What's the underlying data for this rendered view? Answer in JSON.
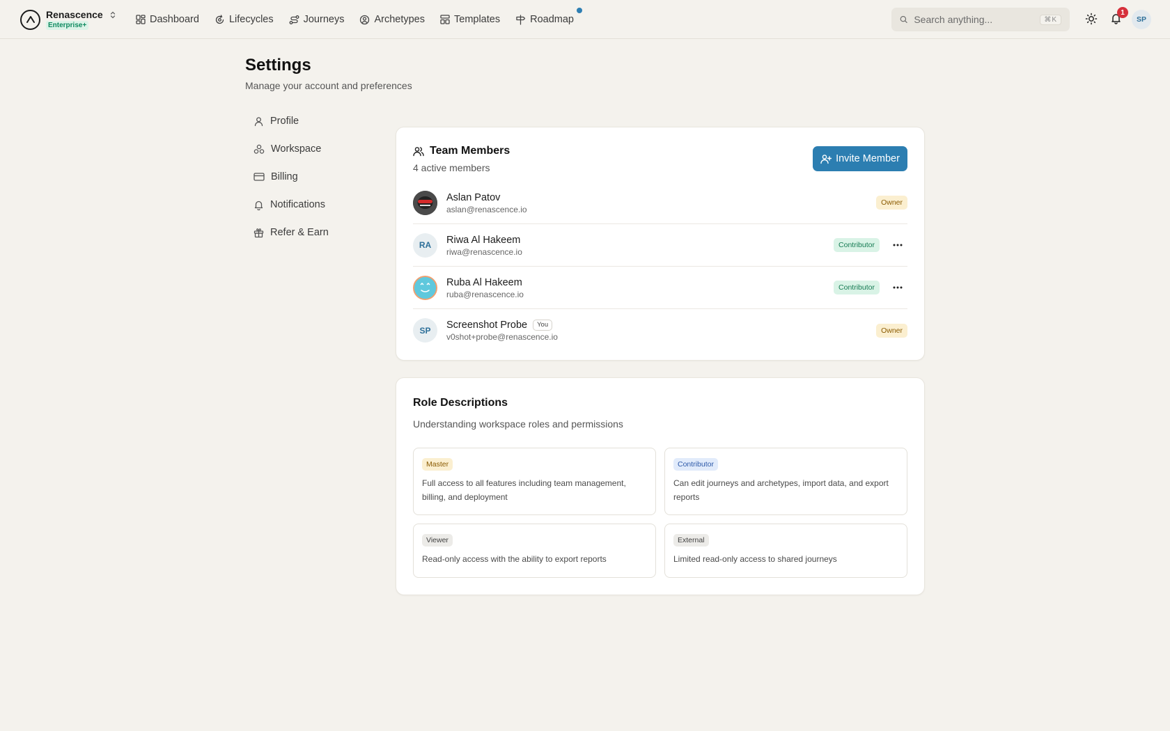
{
  "brand": {
    "name": "Renascence",
    "plan": "Enterprise+"
  },
  "nav": {
    "items": [
      {
        "label": "Dashboard",
        "icon": "grid-icon"
      },
      {
        "label": "Lifecycles",
        "icon": "cycle-icon"
      },
      {
        "label": "Journeys",
        "icon": "route-icon"
      },
      {
        "label": "Archetypes",
        "icon": "user-circle-icon"
      },
      {
        "label": "Templates",
        "icon": "template-icon"
      },
      {
        "label": "Roadmap",
        "icon": "signpost-icon"
      }
    ]
  },
  "search": {
    "placeholder": "Search anything...",
    "shortcut": "⌘K"
  },
  "notifications": {
    "count": "1"
  },
  "user": {
    "initials": "SP"
  },
  "page": {
    "title": "Settings",
    "subtitle": "Manage your account and preferences"
  },
  "side_nav": {
    "items": [
      {
        "label": "Profile",
        "icon": "user-icon"
      },
      {
        "label": "Workspace",
        "icon": "workspace-icon"
      },
      {
        "label": "Billing",
        "icon": "credit-card-icon"
      },
      {
        "label": "Notifications",
        "icon": "bell-icon"
      },
      {
        "label": "Refer & Earn",
        "icon": "gift-icon"
      }
    ]
  },
  "team": {
    "title": "Team Members",
    "subtitle": "4 active members",
    "invite_label": "Invite Member",
    "members": [
      {
        "name": "Aslan Patov",
        "email": "aslan@renascence.io",
        "role": "Owner",
        "initials": ""
      },
      {
        "name": "Riwa Al Hakeem",
        "email": "riwa@renascence.io",
        "role": "Contributor",
        "initials": "RA"
      },
      {
        "name": "Ruba Al Hakeem",
        "email": "ruba@renascence.io",
        "role": "Contributor",
        "initials": ""
      },
      {
        "name": "Screenshot Probe",
        "email": "v0shot+probe@renascence.io",
        "role": "Owner",
        "initials": "SP",
        "you_label": "You"
      }
    ]
  },
  "roles": {
    "title": "Role Descriptions",
    "subtitle": "Understanding workspace roles and permissions",
    "items": [
      {
        "name": "Master",
        "description": "Full access to all features including team management, billing, and deployment"
      },
      {
        "name": "Contributor",
        "description": "Can edit journeys and archetypes, import data, and export reports"
      },
      {
        "name": "Viewer",
        "description": "Read-only access with the ability to export reports"
      },
      {
        "name": "External",
        "description": "Limited read-only access to shared journeys"
      }
    ]
  },
  "colors": {
    "accent": "#2c7eb1",
    "background": "#f4f2ed",
    "owner_badge": "#fbefd0",
    "contributor_badge": "#d9f3e6",
    "notification_badge": "#d6303b"
  }
}
